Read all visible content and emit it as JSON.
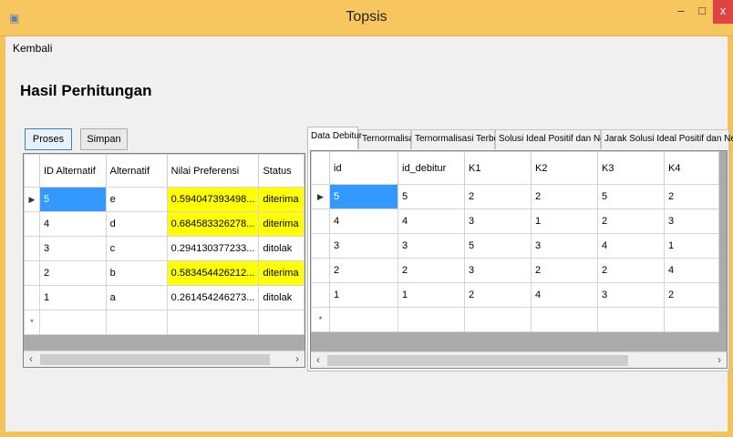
{
  "window": {
    "title": "Topsis",
    "minimize": "–",
    "maximize": "□",
    "close": "x",
    "icon": "app-window-icon"
  },
  "menu": {
    "back": "Kembali"
  },
  "page": {
    "title": "Hasil Perhitungan"
  },
  "buttons": {
    "proses": "Proses",
    "simpan": "Simpan"
  },
  "results": {
    "headers": [
      "ID Alternatif",
      "Alternatif",
      "Nilai Preferensi",
      "Status"
    ],
    "rows": [
      [
        "5",
        "e",
        "0.594047393498...",
        "diterima"
      ],
      [
        "4",
        "d",
        "0.684583326278...",
        "diterima"
      ],
      [
        "3",
        "c",
        "0.294130377233...",
        "ditolak"
      ],
      [
        "2",
        "b",
        "0.583454426212...",
        "diterima"
      ],
      [
        "1",
        "a",
        "0.261454246273...",
        "ditolak"
      ]
    ]
  },
  "tabs": [
    "Data Debitur",
    "Ternormalisasi",
    "Ternormalisasi Terbobot",
    "Solusi Ideal Positif dan Negatif",
    "Jarak Solusi Ideal Positif dan Negatif"
  ],
  "debitur": {
    "headers": [
      "id",
      "id_debitur",
      "K1",
      "K2",
      "K3",
      "K4"
    ],
    "rows": [
      [
        "5",
        "5",
        "2",
        "2",
        "5",
        "2"
      ],
      [
        "4",
        "4",
        "3",
        "1",
        "2",
        "3"
      ],
      [
        "3",
        "3",
        "5",
        "3",
        "4",
        "1"
      ],
      [
        "2",
        "2",
        "3",
        "2",
        "2",
        "4"
      ],
      [
        "1",
        "1",
        "2",
        "4",
        "3",
        "2"
      ]
    ]
  },
  "glyphs": {
    "current_row": "▶",
    "new_row": "*",
    "scroll_left": "‹",
    "scroll_right": "›"
  },
  "colors": {
    "title_bar": "#f7c65f",
    "selected_cell": "#3399ff",
    "accepted_highlight": "#ffff00"
  }
}
